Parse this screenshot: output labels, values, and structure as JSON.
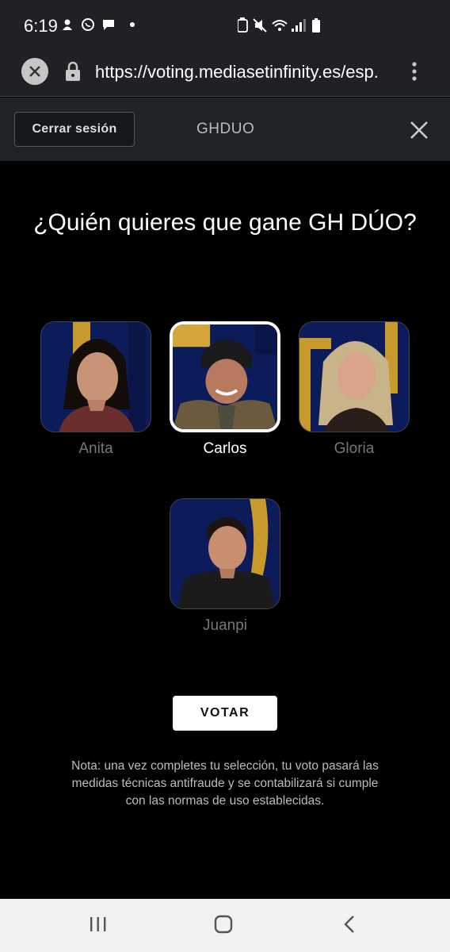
{
  "status_bar": {
    "time": "6:19"
  },
  "browser": {
    "url": "https://voting.mediasetinfinity.es/esp."
  },
  "header": {
    "logout_label": "Cerrar sesión",
    "title": "GHDUO"
  },
  "main": {
    "question": "¿Quién quieres que gane GH DÚO?",
    "candidates": [
      {
        "name": "Anita",
        "selected": false
      },
      {
        "name": "Carlos",
        "selected": true
      },
      {
        "name": "Gloria",
        "selected": false
      },
      {
        "name": "Juanpi",
        "selected": false
      }
    ],
    "vote_label": "VOTAR",
    "note": "Nota: una vez completes tu selección, tu voto pasará las medidas técnicas antifraude y se contabilizará si cumple con las normas de uso establecidas."
  },
  "colors": {
    "background": "#000000",
    "header_bg": "#1f2326",
    "photo_bg": "#0b1a55",
    "accent_gold": "#d4a53a"
  }
}
